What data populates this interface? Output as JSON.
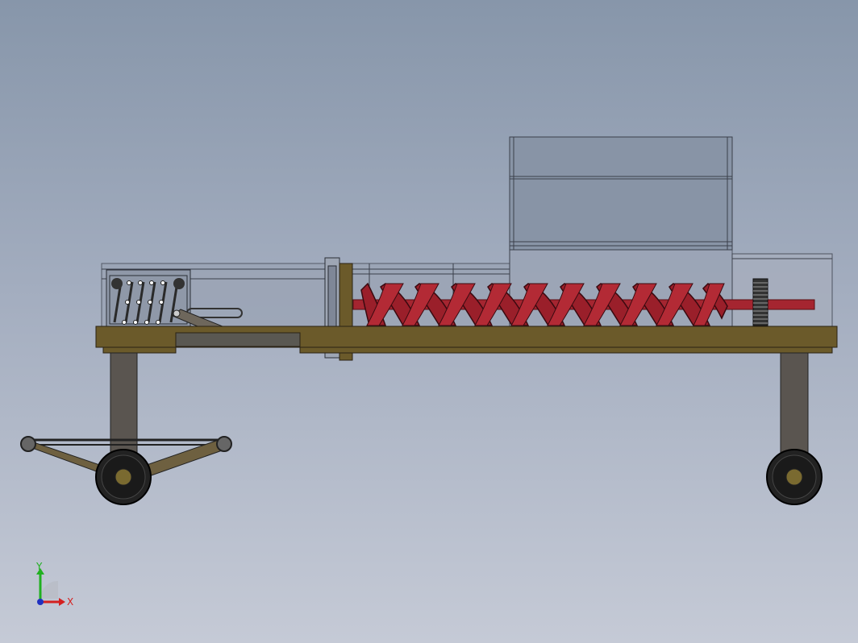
{
  "viewport": {
    "background_top": "#8796aa",
    "background_bottom": "#c5cad6"
  },
  "triad": {
    "x_label": "X",
    "y_label": "Y",
    "x_color": "#d42020",
    "y_color": "#20b020",
    "z_color": "#2030c0"
  },
  "model": {
    "frame_color": "#6b5a2a",
    "leg_color": "#5a5550",
    "auger_color": "#9a1f2a",
    "wheel_color": "#222222",
    "hub_color": "#7a6a30"
  }
}
